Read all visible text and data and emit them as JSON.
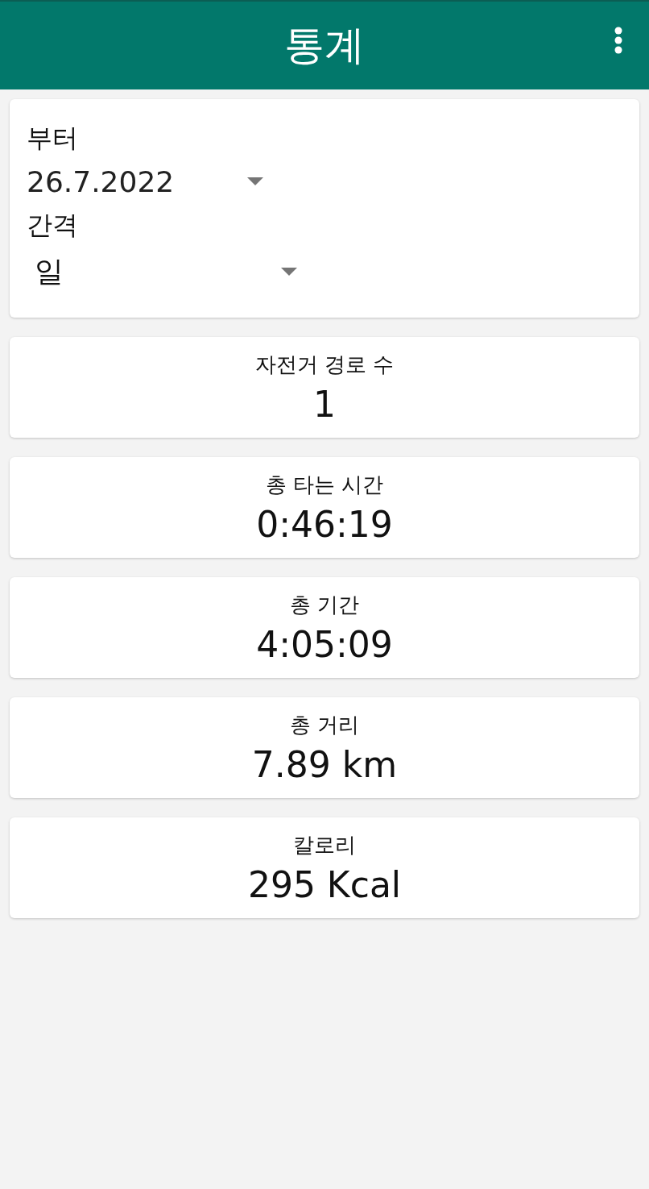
{
  "app_bar": {
    "title": "통계"
  },
  "filter": {
    "from_label": "부터",
    "from_value": "26.7.2022",
    "interval_label": "간격",
    "interval_value": "일"
  },
  "stats": [
    {
      "label": "자전거 경로 수",
      "value": "1"
    },
    {
      "label": "총 타는 시간",
      "value": "0:46:19"
    },
    {
      "label": "총 기간",
      "value": "4:05:09"
    },
    {
      "label": "총 거리",
      "value": "7.89 km"
    },
    {
      "label": "칼로리",
      "value": "295 Kcal"
    }
  ]
}
